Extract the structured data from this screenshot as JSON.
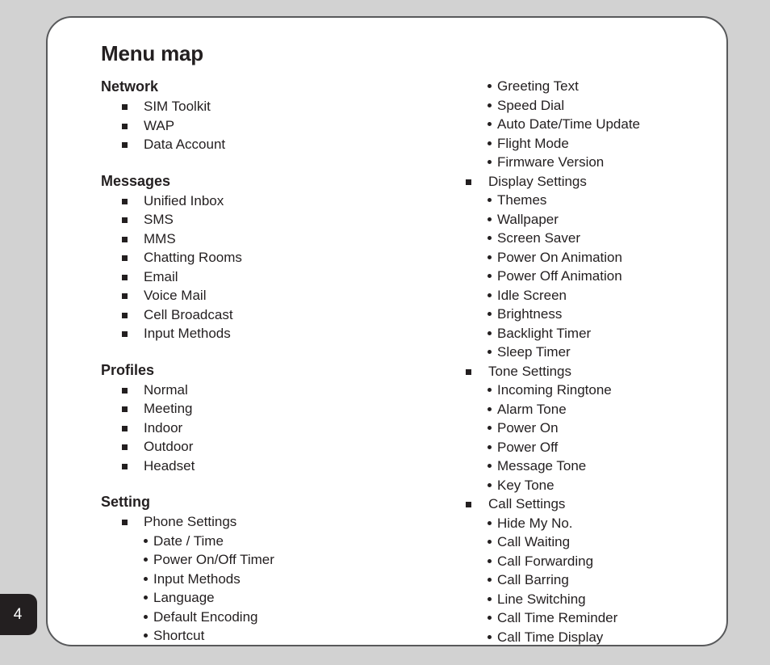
{
  "document": {
    "title": "Menu map",
    "page_number": "4",
    "colors": {
      "background": "#d2d2d2",
      "card": "#ffffff",
      "card_border": "#58595b",
      "text": "#231f20",
      "tab_background": "#231f20",
      "tab_text": "#ffffff"
    }
  },
  "left_column": {
    "sections": [
      {
        "title": "Network",
        "items": [
          {
            "label": "SIM Toolkit",
            "level": 1
          },
          {
            "label": "WAP",
            "level": 1
          },
          {
            "label": "Data Account",
            "level": 1
          }
        ]
      },
      {
        "title": "Messages",
        "items": [
          {
            "label": "Unified Inbox",
            "level": 1
          },
          {
            "label": "SMS",
            "level": 1
          },
          {
            "label": "MMS",
            "level": 1
          },
          {
            "label": "Chatting Rooms",
            "level": 1
          },
          {
            "label": "Email",
            "level": 1
          },
          {
            "label": "Voice Mail",
            "level": 1
          },
          {
            "label": "Cell Broadcast",
            "level": 1
          },
          {
            "label": "Input Methods",
            "level": 1
          }
        ]
      },
      {
        "title": "Profiles",
        "items": [
          {
            "label": "Normal",
            "level": 1
          },
          {
            "label": "Meeting",
            "level": 1
          },
          {
            "label": "Indoor",
            "level": 1
          },
          {
            "label": "Outdoor",
            "level": 1
          },
          {
            "label": "Headset",
            "level": 1
          }
        ]
      },
      {
        "title": "Setting",
        "items": [
          {
            "label": "Phone Settings",
            "level": 1
          },
          {
            "label": "Date / Time",
            "level": 2
          },
          {
            "label": "Power On/Off Timer",
            "level": 2
          },
          {
            "label": "Input Methods",
            "level": 2
          },
          {
            "label": "Language",
            "level": 2
          },
          {
            "label": "Default Encoding",
            "level": 2
          },
          {
            "label": "Shortcut",
            "level": 2
          }
        ]
      }
    ]
  },
  "right_column": {
    "sections": [
      {
        "title": "",
        "items": [
          {
            "label": "Greeting Text",
            "level": 2
          },
          {
            "label": "Speed Dial",
            "level": 2
          },
          {
            "label": "Auto Date/Time Update",
            "level": 2
          },
          {
            "label": "Flight Mode",
            "level": 2
          },
          {
            "label": "Firmware Version",
            "level": 2
          },
          {
            "label": "Display Settings",
            "level": 1
          },
          {
            "label": "Themes",
            "level": 2
          },
          {
            "label": "Wallpaper",
            "level": 2
          },
          {
            "label": "Screen Saver",
            "level": 2
          },
          {
            "label": "Power On Animation",
            "level": 2
          },
          {
            "label": "Power Off Animation",
            "level": 2
          },
          {
            "label": "Idle Screen",
            "level": 2
          },
          {
            "label": "Brightness",
            "level": 2
          },
          {
            "label": "Backlight Timer",
            "level": 2
          },
          {
            "label": "Sleep Timer",
            "level": 2
          },
          {
            "label": "Tone Settings",
            "level": 1
          },
          {
            "label": "Incoming Ringtone",
            "level": 2
          },
          {
            "label": "Alarm Tone",
            "level": 2
          },
          {
            "label": "Power On",
            "level": 2
          },
          {
            "label": "Power Off",
            "level": 2
          },
          {
            "label": "Message Tone",
            "level": 2
          },
          {
            "label": "Key Tone",
            "level": 2
          },
          {
            "label": "Call Settings",
            "level": 1
          },
          {
            "label": "Hide My No.",
            "level": 2
          },
          {
            "label": "Call Waiting",
            "level": 2
          },
          {
            "label": "Call Forwarding",
            "level": 2
          },
          {
            "label": "Call Barring",
            "level": 2
          },
          {
            "label": "Line Switching",
            "level": 2
          },
          {
            "label": "Call Time Reminder",
            "level": 2
          },
          {
            "label": "Call Time Display",
            "level": 2
          }
        ]
      }
    ]
  }
}
